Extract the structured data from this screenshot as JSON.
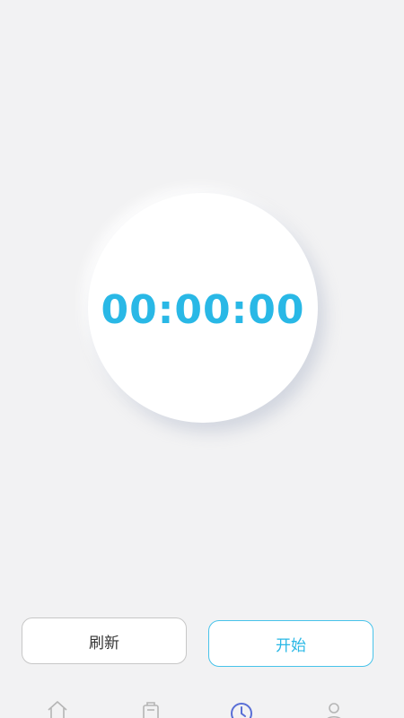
{
  "timer": {
    "display": "00:00:00"
  },
  "buttons": {
    "refresh_label": "刷新",
    "start_label": "开始"
  },
  "tabbar": {
    "items": [
      {
        "icon": "home-icon"
      },
      {
        "icon": "bag-icon"
      },
      {
        "icon": "clock-icon",
        "active": true
      },
      {
        "icon": "user-icon"
      }
    ]
  },
  "colors": {
    "accent": "#29b8e6",
    "active_tab": "#5a6fd6",
    "inactive_tab": "#b5b5b5",
    "background": "#f2f2f3"
  }
}
